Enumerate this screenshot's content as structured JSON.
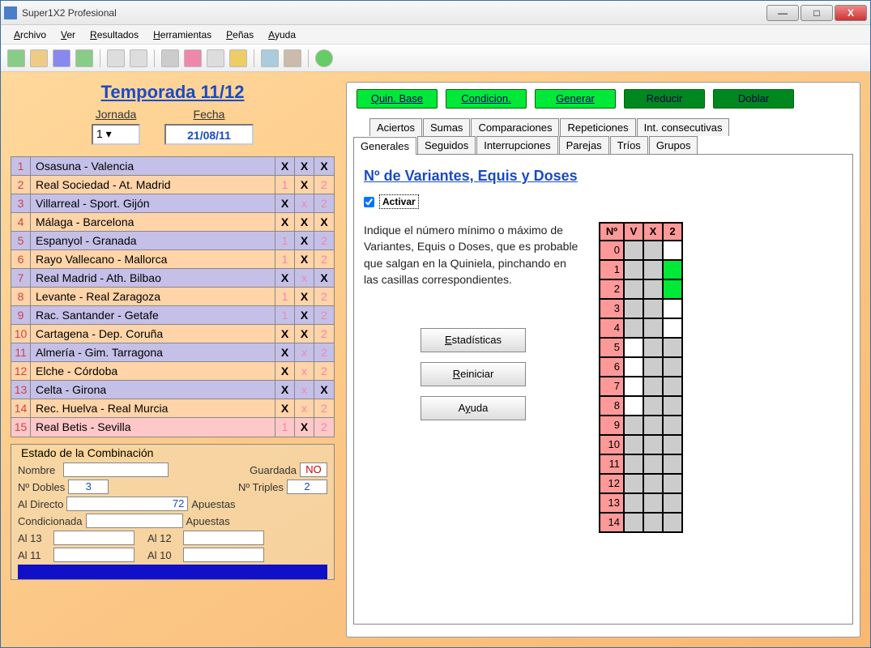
{
  "title": "Super1X2 Profesional",
  "menu": [
    "Archivo",
    "Ver",
    "Resultados",
    "Herramientas",
    "Peñas",
    "Ayuda"
  ],
  "season": "Temporada 11/12",
  "jornada_label": "Jornada",
  "fecha_label": "Fecha",
  "jornada": "1",
  "fecha": "21/08/11",
  "matches": [
    {
      "n": "1",
      "name": "Osasuna - Valencia",
      "c": "rowpurple",
      "v": [
        "X",
        "X",
        "X"
      ],
      "s": [
        1,
        1,
        1
      ]
    },
    {
      "n": "2",
      "name": "Real Sociedad - At. Madrid",
      "c": "roworange",
      "v": [
        "1",
        "X",
        "2"
      ],
      "s": [
        0,
        1,
        0
      ]
    },
    {
      "n": "3",
      "name": "Villarreal - Sport. Gijón",
      "c": "rowpurple",
      "v": [
        "X",
        "x",
        "2"
      ],
      "s": [
        1,
        0,
        0
      ]
    },
    {
      "n": "4",
      "name": "Málaga - Barcelona",
      "c": "roworange",
      "v": [
        "X",
        "X",
        "X"
      ],
      "s": [
        1,
        1,
        1
      ]
    },
    {
      "n": "5",
      "name": "Espanyol - Granada",
      "c": "rowpurple",
      "v": [
        "1",
        "X",
        "2"
      ],
      "s": [
        0,
        1,
        0
      ]
    },
    {
      "n": "6",
      "name": "Rayo Vallecano - Mallorca",
      "c": "roworange",
      "v": [
        "1",
        "X",
        "2"
      ],
      "s": [
        0,
        1,
        0
      ]
    },
    {
      "n": "7",
      "name": "Real Madrid - Ath. Bilbao",
      "c": "rowpurple",
      "v": [
        "X",
        "x",
        "X"
      ],
      "s": [
        1,
        0,
        1
      ]
    },
    {
      "n": "8",
      "name": "Levante - Real Zaragoza",
      "c": "roworange",
      "v": [
        "1",
        "X",
        "2"
      ],
      "s": [
        0,
        1,
        0
      ]
    },
    {
      "n": "9",
      "name": "Rac. Santander - Getafe",
      "c": "rowpurple",
      "v": [
        "1",
        "X",
        "2"
      ],
      "s": [
        0,
        1,
        0
      ]
    },
    {
      "n": "10",
      "name": "Cartagena - Dep. Coruña",
      "c": "roworange",
      "v": [
        "X",
        "X",
        "2"
      ],
      "s": [
        1,
        1,
        0
      ]
    },
    {
      "n": "11",
      "name": "Almería - Gim. Tarragona",
      "c": "rowpurple",
      "v": [
        "X",
        "x",
        "2"
      ],
      "s": [
        1,
        0,
        0
      ]
    },
    {
      "n": "12",
      "name": "Elche - Córdoba",
      "c": "roworange",
      "v": [
        "X",
        "x",
        "2"
      ],
      "s": [
        1,
        0,
        0
      ]
    },
    {
      "n": "13",
      "name": "Celta - Girona",
      "c": "rowpurple",
      "v": [
        "X",
        "x",
        "X"
      ],
      "s": [
        1,
        0,
        1
      ]
    },
    {
      "n": "14",
      "name": "Rec. Huelva - Real Murcia",
      "c": "roworange",
      "v": [
        "X",
        "x",
        "2"
      ],
      "s": [
        1,
        0,
        0
      ]
    },
    {
      "n": "15",
      "name": "Real Betis - Sevilla",
      "c": "rowpink",
      "v": [
        "1",
        "X",
        "2"
      ],
      "s": [
        0,
        1,
        0
      ]
    }
  ],
  "combo": {
    "title": "Estado de la Combinación",
    "nombre": "Nombre",
    "guardada": "Guardada",
    "guardada_val": "NO",
    "ndobles": "Nº Dobles",
    "ndobles_val": "3",
    "ntriples": "Nº Triples",
    "ntriples_val": "2",
    "directo": "Al Directo",
    "directo_val": "72",
    "apuestas": "Apuestas",
    "cond": "Condicionada",
    "al13": "Al 13",
    "al12": "Al 12",
    "al11": "Al 11",
    "al10": "Al 10"
  },
  "actions": [
    "Quin. Base",
    "Condicion.",
    "Generar",
    "Reducir",
    "Doblar"
  ],
  "tabs_row1": [
    "Aciertos",
    "Sumas",
    "Comparaciones",
    "Repeticiones",
    "Int. consecutivas"
  ],
  "tabs_row2": [
    "Generales",
    "Seguidos",
    "Interrupciones",
    "Parejas",
    "Tríos",
    "Grupos"
  ],
  "panel": {
    "title": "Nº de Variantes, Equis y Doses",
    "activar": "Activar",
    "desc": "Indique el número mínimo o máximo de Variantes, Equis o Doses, que es probable que salgan en la Quiniela, pinchando en las casillas correspondientes.",
    "btns": {
      "est": "Estadísticas",
      "rei": "Reiniciar",
      "ayu": "Ayuda"
    },
    "headers": [
      "Nº",
      "V",
      "X",
      "2"
    ],
    "rows": [
      {
        "n": "0",
        "c": [
          "lg",
          "lg",
          "wh"
        ]
      },
      {
        "n": "1",
        "c": [
          "lg",
          "lg",
          "gr"
        ]
      },
      {
        "n": "2",
        "c": [
          "lg",
          "lg",
          "gr"
        ]
      },
      {
        "n": "3",
        "c": [
          "lg",
          "lg",
          "wh"
        ]
      },
      {
        "n": "4",
        "c": [
          "lg",
          "lg",
          "wh"
        ]
      },
      {
        "n": "5",
        "c": [
          "wh",
          "lg",
          "lg"
        ]
      },
      {
        "n": "6",
        "c": [
          "wh",
          "lg",
          "lg"
        ]
      },
      {
        "n": "7",
        "c": [
          "wh",
          "lg",
          "lg"
        ]
      },
      {
        "n": "8",
        "c": [
          "wh",
          "lg",
          "lg"
        ]
      },
      {
        "n": "9",
        "c": [
          "lg",
          "lg",
          "lg"
        ]
      },
      {
        "n": "10",
        "c": [
          "lg",
          "lg",
          "lg"
        ]
      },
      {
        "n": "11",
        "c": [
          "lg",
          "lg",
          "lg"
        ]
      },
      {
        "n": "12",
        "c": [
          "lg",
          "lg",
          "lg"
        ]
      },
      {
        "n": "13",
        "c": [
          "lg",
          "lg",
          "lg"
        ]
      },
      {
        "n": "14",
        "c": [
          "lg",
          "lg",
          "lg"
        ]
      }
    ]
  }
}
